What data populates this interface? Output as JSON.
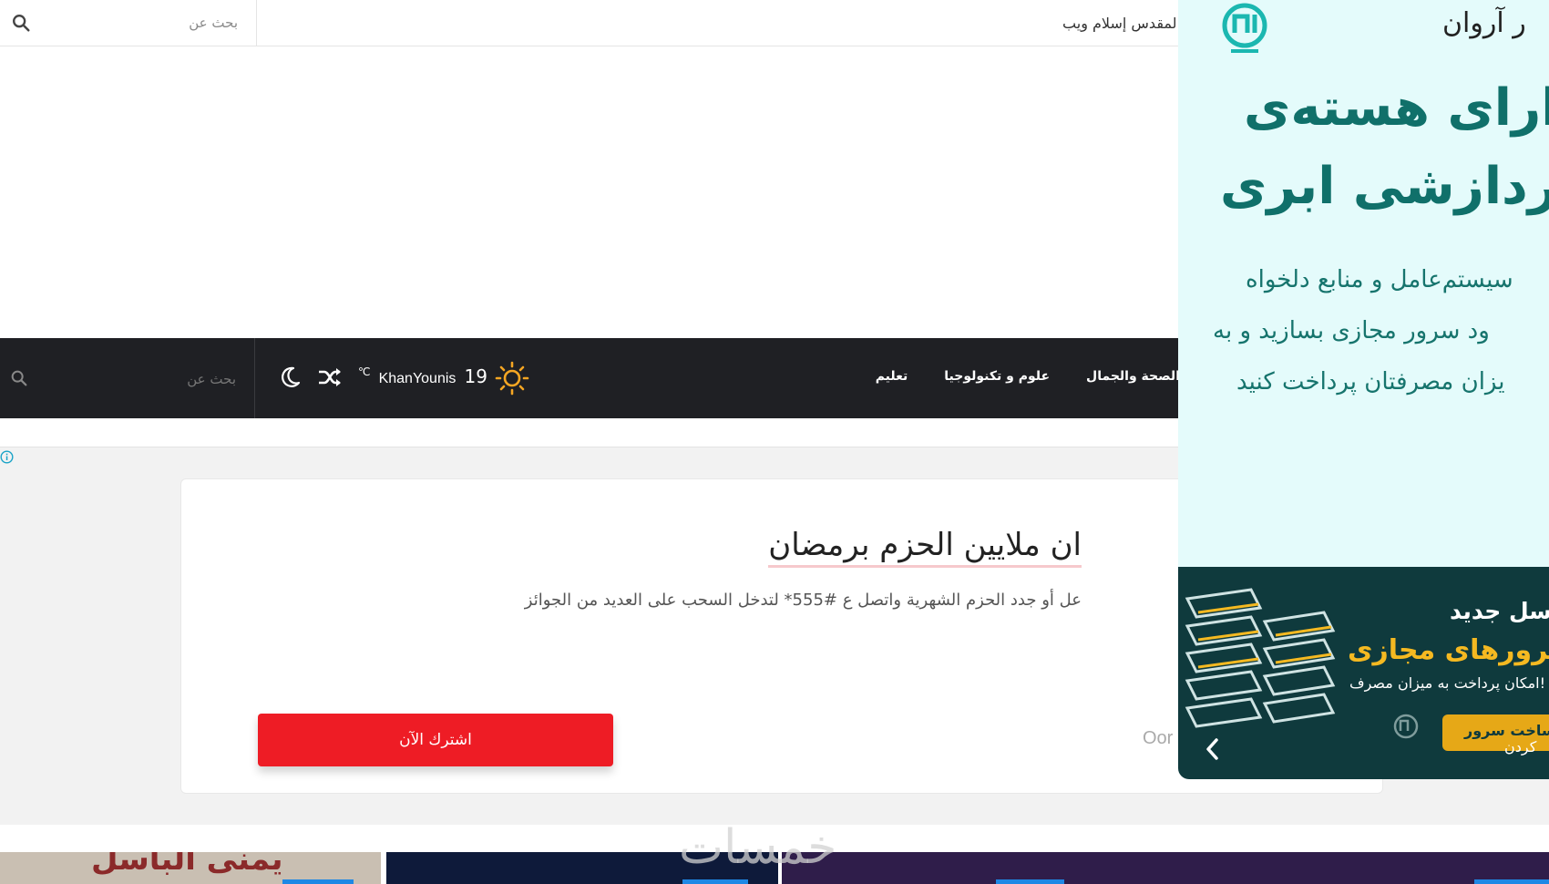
{
  "topbar": {
    "search_placeholder": "بحث عن",
    "ticker_text": "المقدس إسلام ويب"
  },
  "nav": {
    "search_placeholder": "بحث عن",
    "weather": {
      "temp": "19",
      "city": "KhanYounis",
      "unit": "℃"
    },
    "links": [
      "الصحة والجمال",
      "علوم و تكنولوجيا",
      "تعليم"
    ]
  },
  "promo": {
    "title": "ان ملايين الحزم برمضان",
    "description": "عل أو جدد الحزم الشهرية واتصل ع #555* لتدخل السحب على العديد من الجوائز",
    "brand": "Oor",
    "button_label": "اشترك الآن"
  },
  "thumbnails": {
    "first_text": "يمنى الباسل"
  },
  "watermark": "خمسات",
  "ad": {
    "brand": "ر آروان",
    "headline_1": "دارای هسته‌ی",
    "headline_2": "پردازشی ابری",
    "lines": [
      "سیستم‌عامل و منابع دلخواه",
      "ود سرور مجازی بسازید و به",
      "یزان مصرفتان پرداخت کنید"
    ],
    "banner": {
      "title": "سل جدید",
      "subtitle": "سرورهای مجازی",
      "note": "امکان پرداخت به میزان مصرف!",
      "button": "ساخت سرور",
      "small": "کردن"
    }
  },
  "colors": {
    "nav_bg": "#1f2024",
    "accent_red": "#ee1c25",
    "ad_teal": "#10706a",
    "ad_banner_bg": "#0f3a3d",
    "ad_gold": "#f5b921",
    "sun": "#f5a623"
  },
  "icons": [
    "search-icon",
    "moon-icon",
    "shuffle-icon",
    "sun-icon",
    "info-icon",
    "chevron-left-icon",
    "arvan-logo"
  ]
}
